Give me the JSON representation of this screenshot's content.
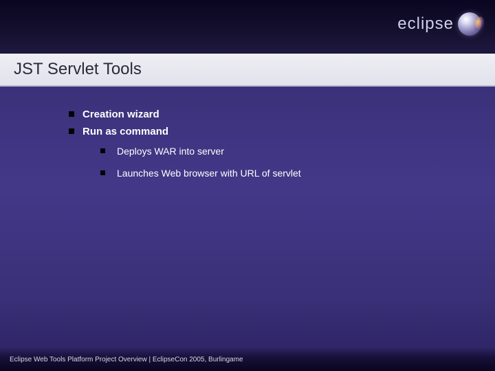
{
  "brand": {
    "name": "eclipse"
  },
  "slide": {
    "title": "JST Servlet Tools",
    "bullets": [
      {
        "text": "Creation wizard"
      },
      {
        "text": "Run as command",
        "children": [
          {
            "text": "Deploys WAR into server"
          },
          {
            "text": "Launches Web browser with URL of servlet"
          }
        ]
      }
    ]
  },
  "footer": {
    "text": "Eclipse Web Tools Platform Project Overview  |  EclipseCon 2005, Burlingame"
  }
}
